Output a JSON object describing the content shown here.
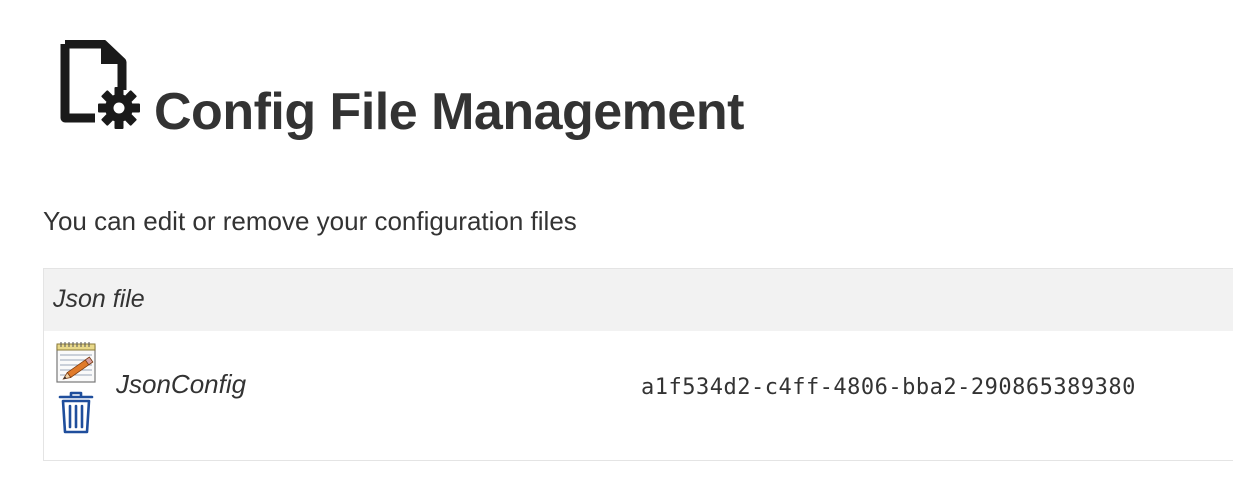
{
  "header": {
    "title": "Config File Management",
    "icon": "file-gear-icon"
  },
  "description": "You can edit or remove your configuration files",
  "table": {
    "header_label": "Json file",
    "rows": [
      {
        "name": "JsonConfig",
        "id": "a1f534d2-c4ff-4806-bba2-290865389380",
        "actions": [
          "edit-icon",
          "delete-icon"
        ]
      }
    ]
  },
  "colors": {
    "text": "#333333",
    "header_bg": "#f2f2f2",
    "border": "#e4e4e4",
    "trash_blue": "#1f4e9c"
  }
}
